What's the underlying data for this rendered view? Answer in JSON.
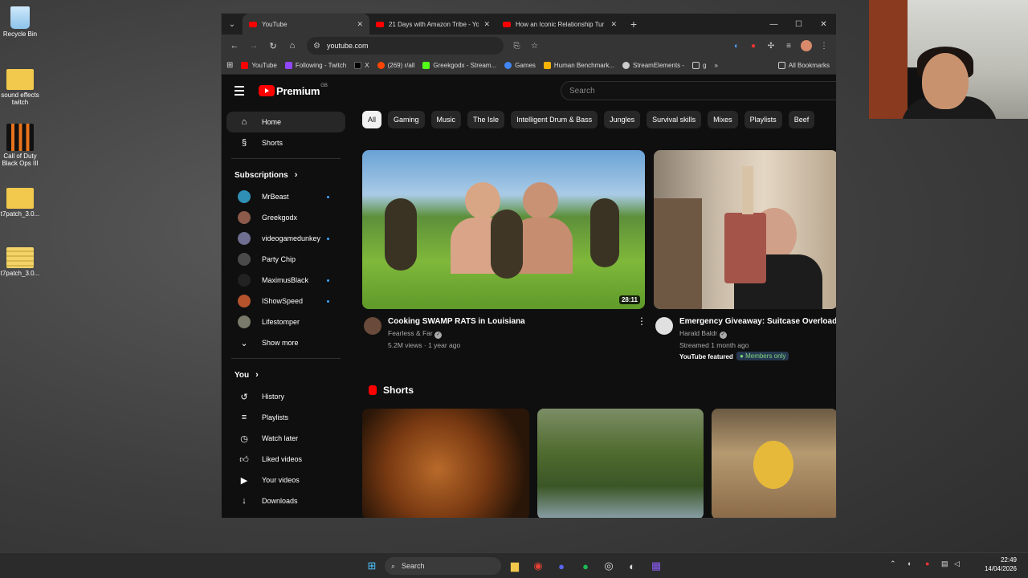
{
  "desktop": {
    "icons": [
      {
        "label": "Recycle Bin",
        "name": "recycle-bin-icon",
        "color": "#9fd2f5"
      },
      {
        "label": "sound effects twitch",
        "name": "folder-icon",
        "color": "#f2c94c"
      },
      {
        "label": "Call of Duty Black Ops III",
        "name": "game-icon",
        "color": "#e8731c"
      },
      {
        "label": "t7patch_3.0...",
        "name": "folder-icon",
        "color": "#f2c94c"
      },
      {
        "label": "t7patch_3.0...",
        "name": "archive-icon",
        "color": "#f2d46a"
      }
    ]
  },
  "browser": {
    "tabs": [
      {
        "label": "YouTube",
        "active": true
      },
      {
        "label": "21 Days with Amazon Tribe - Yo",
        "active": false
      },
      {
        "label": "How an Iconic Relationship Tur",
        "active": false
      }
    ],
    "new_tab": "+",
    "url": "youtube.com",
    "bookmarks": [
      {
        "label": "YouTube",
        "color": "#ff0000"
      },
      {
        "label": "Following - Twitch",
        "color": "#9146ff"
      },
      {
        "label": "X",
        "color": "#000000"
      },
      {
        "label": "(269) r/all",
        "color": "#ff4500"
      },
      {
        "label": "Greekgodx - Stream...",
        "color": "#53fc18"
      },
      {
        "label": "Games",
        "color": "#4285f4"
      },
      {
        "label": "Human Benchmark...",
        "color": "#f4b400"
      },
      {
        "label": "StreamElements -",
        "color": "#cccccc"
      },
      {
        "label": "g",
        "color": "#cccccc"
      }
    ],
    "all_bookmarks": "All Bookmarks"
  },
  "youtube": {
    "logo": "Premium",
    "region": "GB",
    "search_placeholder": "Search",
    "nav": [
      {
        "label": "Home",
        "icon": "home-icon",
        "active": true
      },
      {
        "label": "Shorts",
        "icon": "shorts-icon",
        "active": false
      }
    ],
    "subscriptions_title": "Subscriptions",
    "subscriptions": [
      {
        "label": "MrBeast",
        "color": "#2f8fb5",
        "live": true
      },
      {
        "label": "Greekgodx",
        "color": "#8b5a4a",
        "live": false
      },
      {
        "label": "videogamedunkey",
        "color": "#6e6e90",
        "live": true
      },
      {
        "label": "Party Chip",
        "color": "#4a4a4a",
        "live": false
      },
      {
        "label": "MaximusBlack",
        "color": "#222222",
        "live": true
      },
      {
        "label": "IShowSpeed",
        "color": "#b5532c",
        "live": true
      },
      {
        "label": "Lifestomper",
        "color": "#7a7a6a",
        "live": false
      }
    ],
    "show_more": "Show more",
    "you_title": "You",
    "you_items": [
      {
        "label": "History",
        "icon": "history-icon"
      },
      {
        "label": "Playlists",
        "icon": "playlists-icon"
      },
      {
        "label": "Watch later",
        "icon": "watch-later-icon"
      },
      {
        "label": "Liked videos",
        "icon": "thumbs-up-icon"
      },
      {
        "label": "Your videos",
        "icon": "your-videos-icon"
      },
      {
        "label": "Downloads",
        "icon": "download-icon"
      }
    ],
    "chips": [
      "All",
      "Gaming",
      "Music",
      "The Isle",
      "Intelligent Drum & Bass",
      "Jungles",
      "Survival skills",
      "Mixes",
      "Playlists",
      "Beef"
    ],
    "videos": [
      {
        "title": "Cooking SWAMP RATS in Louisiana",
        "channel": "Fearless & Far",
        "meta": "5.2M views · 1 year ago",
        "duration": "28:11",
        "verified": "✓"
      },
      {
        "title": "Emergency Giveaway: Suitcase Overloade",
        "channel": "Harald Baldr",
        "meta": "Streamed 1 month ago",
        "featured": "YouTube featured",
        "members": "Members only",
        "verified": "✓"
      }
    ],
    "shorts_title": "Shorts"
  },
  "taskbar": {
    "search": "Search",
    "time": "22:49",
    "date": "14/04/2026"
  }
}
